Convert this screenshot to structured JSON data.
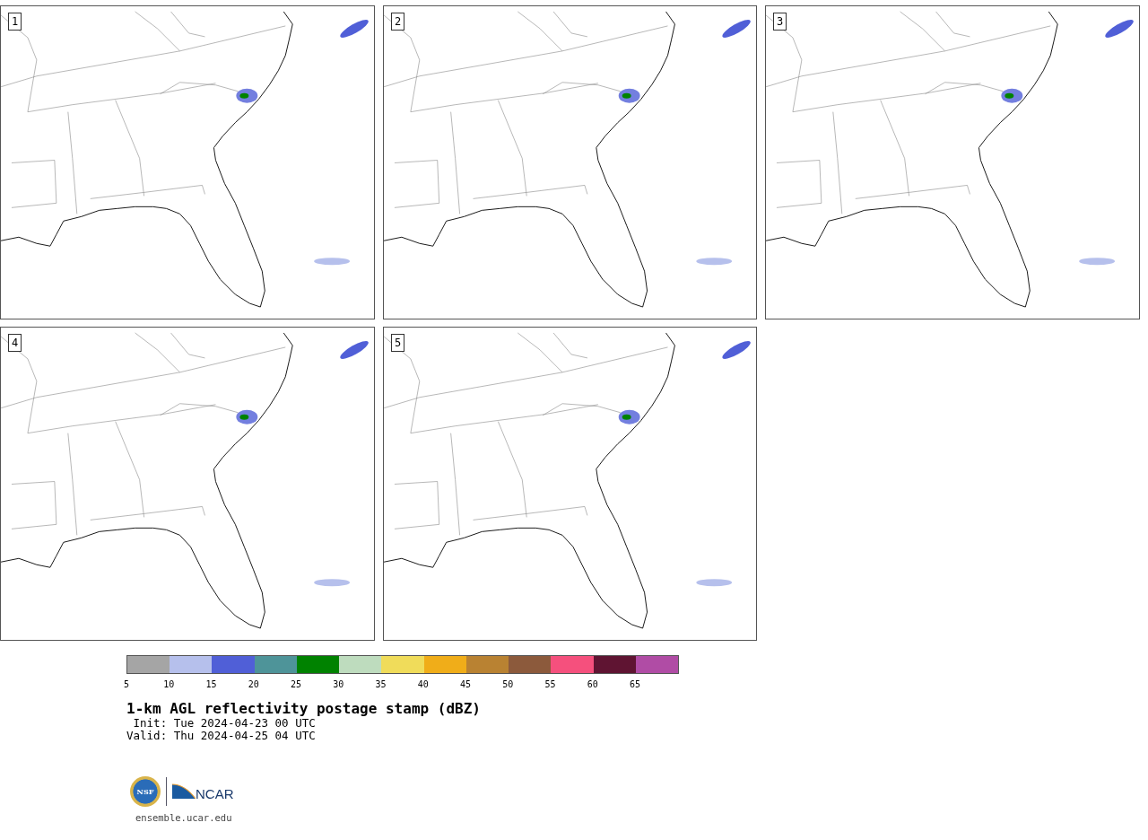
{
  "panels": [
    {
      "label": "1"
    },
    {
      "label": "2"
    },
    {
      "label": "3"
    },
    {
      "label": "4"
    },
    {
      "label": "5"
    }
  ],
  "colorbar": {
    "bins": [
      {
        "color": "#a5a5a5"
      },
      {
        "color": "#b6c0ec"
      },
      {
        "color": "#505fd7"
      },
      {
        "color": "#4e9499"
      },
      {
        "color": "#008200"
      },
      {
        "color": "#bedcbe"
      },
      {
        "color": "#f0dc5a"
      },
      {
        "color": "#f0ad19"
      },
      {
        "color": "#b98232"
      },
      {
        "color": "#8c5a3c"
      },
      {
        "color": "#f5507d"
      },
      {
        "color": "#5f1432"
      },
      {
        "color": "#b04ca5"
      }
    ],
    "ticks": [
      "5",
      "10",
      "15",
      "20",
      "25",
      "30",
      "35",
      "40",
      "45",
      "50",
      "55",
      "60",
      "65"
    ]
  },
  "title": "1-km AGL reflectivity postage stamp (dBZ)",
  "init": " Init: Tue 2024-04-23 00 UTC",
  "valid": "Valid: Thu 2024-04-25 04 UTC",
  "logos": {
    "nsf": "NSF",
    "ncar": "NCAR"
  },
  "url": "ensemble.ucar.edu"
}
